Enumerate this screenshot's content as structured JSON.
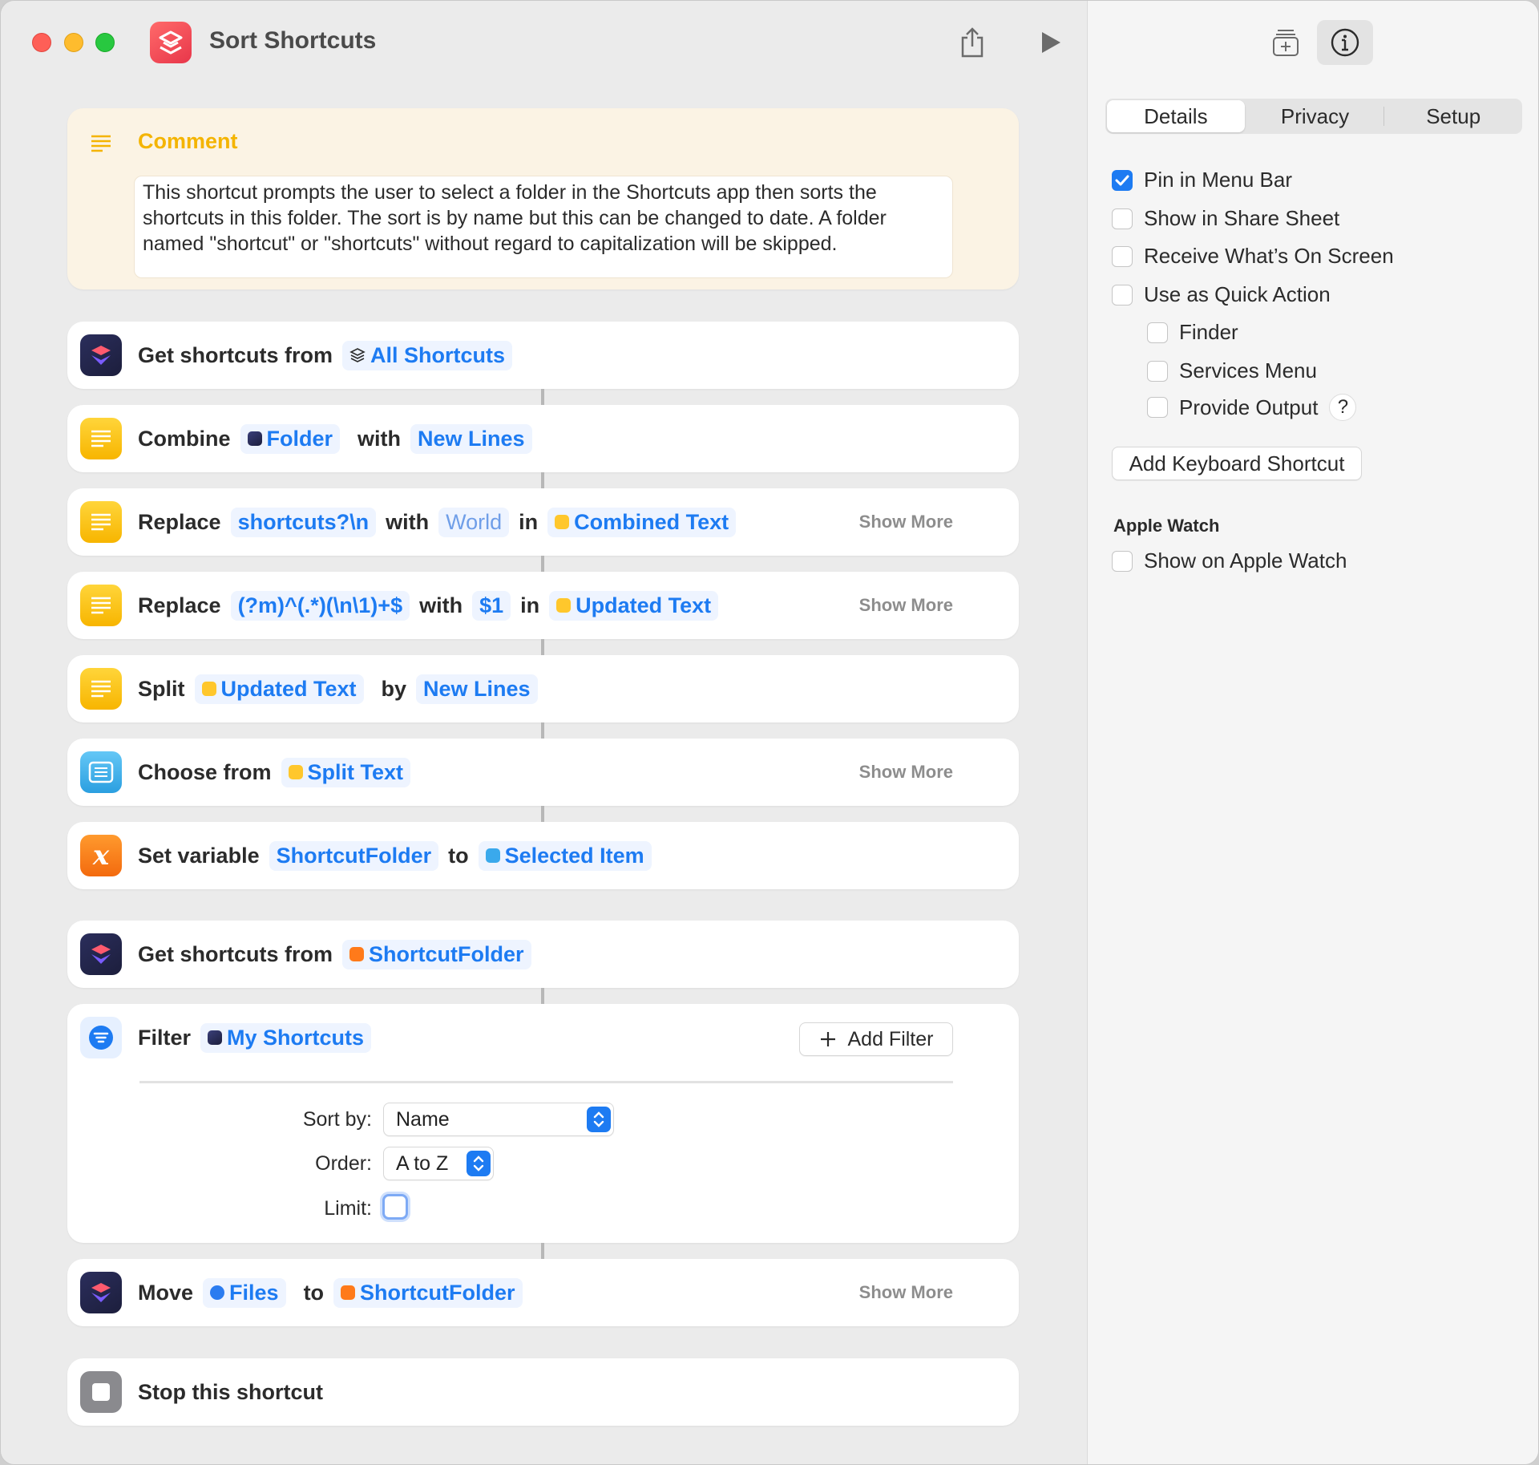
{
  "window": {
    "title": "Sort Shortcuts"
  },
  "comment": {
    "label": "Comment",
    "text": "This shortcut prompts the user to select a folder in the Shortcuts app then sorts the shortcuts in this folder. The sort is by name but this can be changed to date. A folder named \"shortcut\" or \"shortcuts\" without regard to capitalization will be skipped."
  },
  "actions": {
    "get1": {
      "verb": "Get shortcuts from",
      "source": "All Shortcuts"
    },
    "combine": {
      "verb": "Combine",
      "input": "Folder",
      "with": "with",
      "separator": "New Lines"
    },
    "replace1": {
      "verb": "Replace",
      "find": "shortcuts?\\n",
      "with": "with",
      "replacement": "World",
      "in": "in",
      "target": "Combined Text",
      "more": "Show More"
    },
    "replace2": {
      "verb": "Replace",
      "find": "(?m)^(.*)(\\n\\1)+$",
      "with": "with",
      "replacement": "$1",
      "in": "in",
      "target": "Updated Text",
      "more": "Show More"
    },
    "split": {
      "verb": "Split",
      "input": "Updated Text",
      "by": "by",
      "separator": "New Lines"
    },
    "choose": {
      "verb": "Choose from",
      "input": "Split Text",
      "more": "Show More"
    },
    "setvar": {
      "verb": "Set variable",
      "name": "ShortcutFolder",
      "to": "to",
      "value": "Selected Item"
    },
    "get2": {
      "verb": "Get shortcuts from",
      "source": "ShortcutFolder"
    },
    "filter": {
      "verb": "Filter",
      "input": "My Shortcuts",
      "add_filter": "Add Filter",
      "sort_label": "Sort by:",
      "sort_value": "Name",
      "order_label": "Order:",
      "order_value": "A to Z",
      "limit_label": "Limit:"
    },
    "move": {
      "verb": "Move",
      "input": "Files",
      "to": "to",
      "dest": "ShortcutFolder",
      "more": "Show More"
    },
    "stop": {
      "verb": "Stop this shortcut"
    }
  },
  "inspector": {
    "tabs": [
      "Details",
      "Privacy",
      "Setup"
    ],
    "active_tab": "Details",
    "options": {
      "pin_menu_bar": "Pin in Menu Bar",
      "share_sheet": "Show in Share Sheet",
      "on_screen": "Receive What’s On Screen",
      "quick_action": "Use as Quick Action",
      "finder": "Finder",
      "services": "Services Menu",
      "provide_output": "Provide Output",
      "help": "?",
      "keyboard_shortcut": "Add Keyboard Shortcut",
      "apple_watch_title": "Apple Watch",
      "apple_watch": "Show on Apple Watch"
    }
  },
  "colors": {
    "accent": "#1d7bf2",
    "comment_label": "#f4b400",
    "comment_bg": "#fbf3e4",
    "close": "#fe5f57",
    "minimize": "#febc2e",
    "zoom": "#28c840"
  }
}
